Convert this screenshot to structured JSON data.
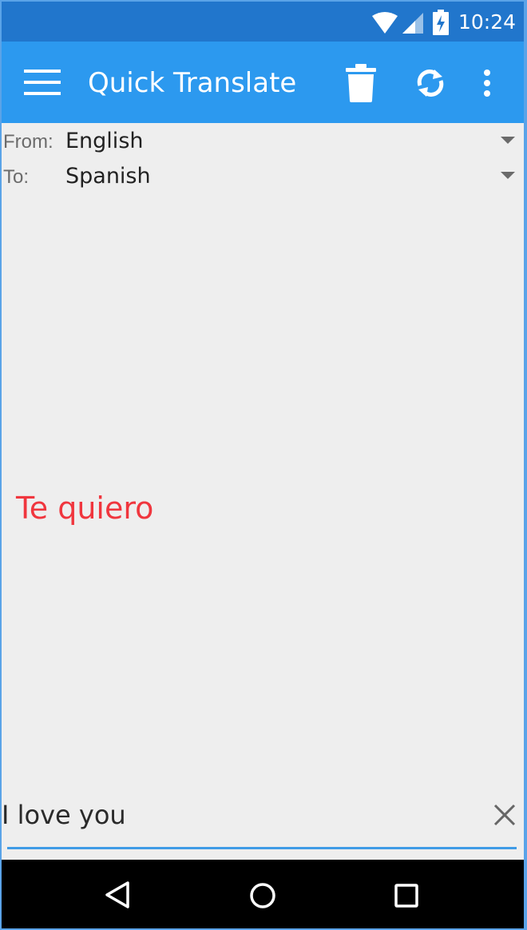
{
  "status_bar": {
    "time": "10:24"
  },
  "toolbar": {
    "title": "Quick Translate"
  },
  "languages": {
    "from_label": "From:",
    "from_value": "English",
    "to_label": "To:",
    "to_value": "Spanish"
  },
  "result": {
    "text": "Te quiero",
    "color": "#f0363e"
  },
  "input": {
    "value": "I love you"
  },
  "colors": {
    "status_bar": "#2176cc",
    "toolbar": "#2c99ef",
    "accent": "#3f9be6",
    "background": "#eeeeee"
  },
  "icons": [
    "wifi-icon",
    "cell-signal-icon",
    "battery-charging-icon",
    "menu-icon",
    "delete-icon",
    "refresh-icon",
    "more-vert-icon",
    "dropdown-arrow-icon",
    "clear-icon",
    "back-icon",
    "home-icon",
    "recents-icon"
  ]
}
